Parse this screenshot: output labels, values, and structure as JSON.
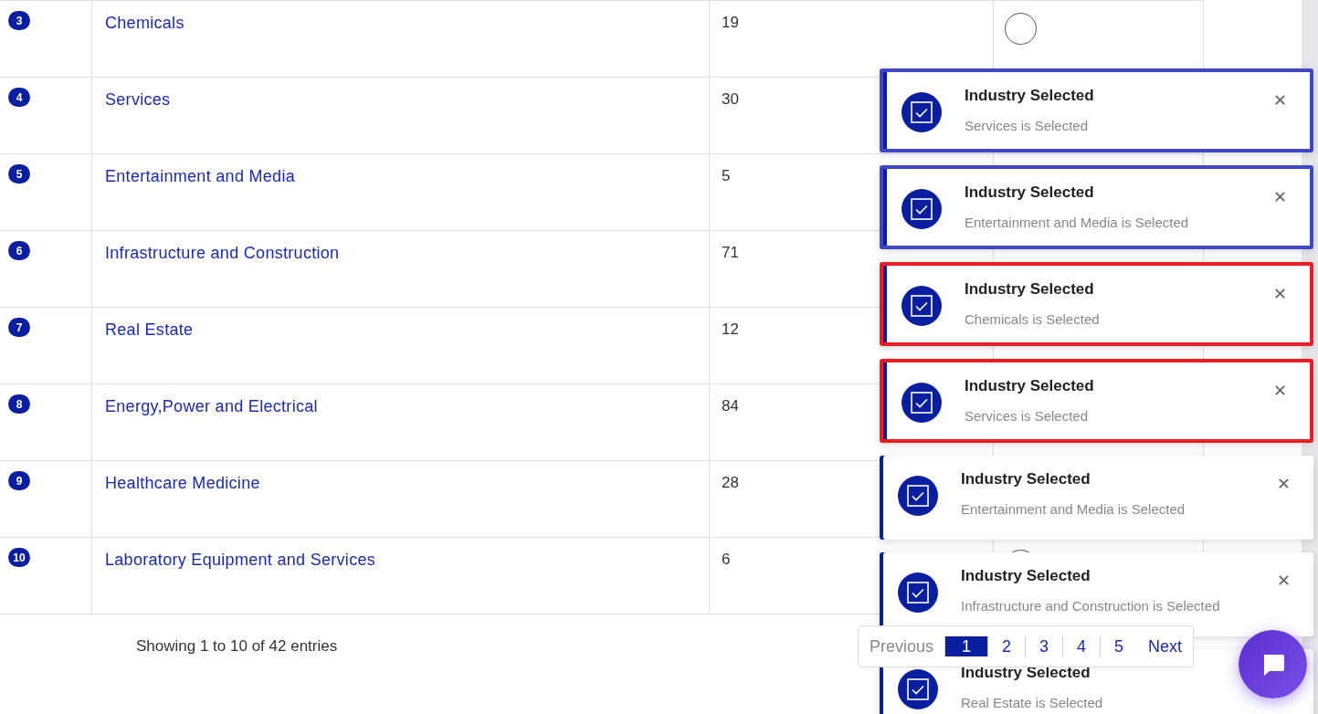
{
  "table": {
    "rows": [
      {
        "index": "3",
        "name": "Chemicals",
        "count": "19",
        "selected": false
      },
      {
        "index": "4",
        "name": "Services",
        "count": "30"
      },
      {
        "index": "5",
        "name": "Entertainment and Media",
        "count": "5"
      },
      {
        "index": "6",
        "name": "Infrastructure and Construction",
        "count": "71"
      },
      {
        "index": "7",
        "name": "Real Estate",
        "count": "12"
      },
      {
        "index": "8",
        "name": "Energy,Power and Electrical",
        "count": "84"
      },
      {
        "index": "9",
        "name": "Healthcare Medicine",
        "count": "28"
      },
      {
        "index": "10",
        "name": "Laboratory Equipment and Services",
        "count": "6",
        "selected": false
      }
    ]
  },
  "info": "Showing 1 to 10 of 42 entries",
  "pagination": {
    "previous": {
      "label": "Previous",
      "disabled": true
    },
    "pages": [
      {
        "label": "1",
        "selected": true
      },
      {
        "label": "2",
        "selected": false
      },
      {
        "label": "3",
        "selected": false
      },
      {
        "label": "4",
        "selected": false
      },
      {
        "label": "5",
        "selected": false
      }
    ],
    "next": {
      "label": "Next",
      "disabled": false
    }
  },
  "toasts": [
    {
      "title": "Industry Selected",
      "message": "Services is Selected",
      "color": "#4046c8",
      "closable": true
    },
    {
      "title": "Industry Selected",
      "message": "Entertainment and Media is Selected",
      "color": "#4046c8",
      "closable": true
    },
    {
      "title": "Industry Selected",
      "message": "Chemicals is Selected",
      "color": "#ec1c24",
      "closable": true
    },
    {
      "title": "Industry Selected",
      "message": "Services is Selected",
      "color": "#ec1c24",
      "closable": true
    },
    {
      "title": "Industry Selected",
      "message": "Entertainment and Media is Selected",
      "closable": true
    },
    {
      "title": "Industry Selected",
      "message": "Infrastructure and Construction is Selected",
      "closable": true
    },
    {
      "title": "Industry Selected",
      "message": "Real Estate is Selected"
    }
  ]
}
